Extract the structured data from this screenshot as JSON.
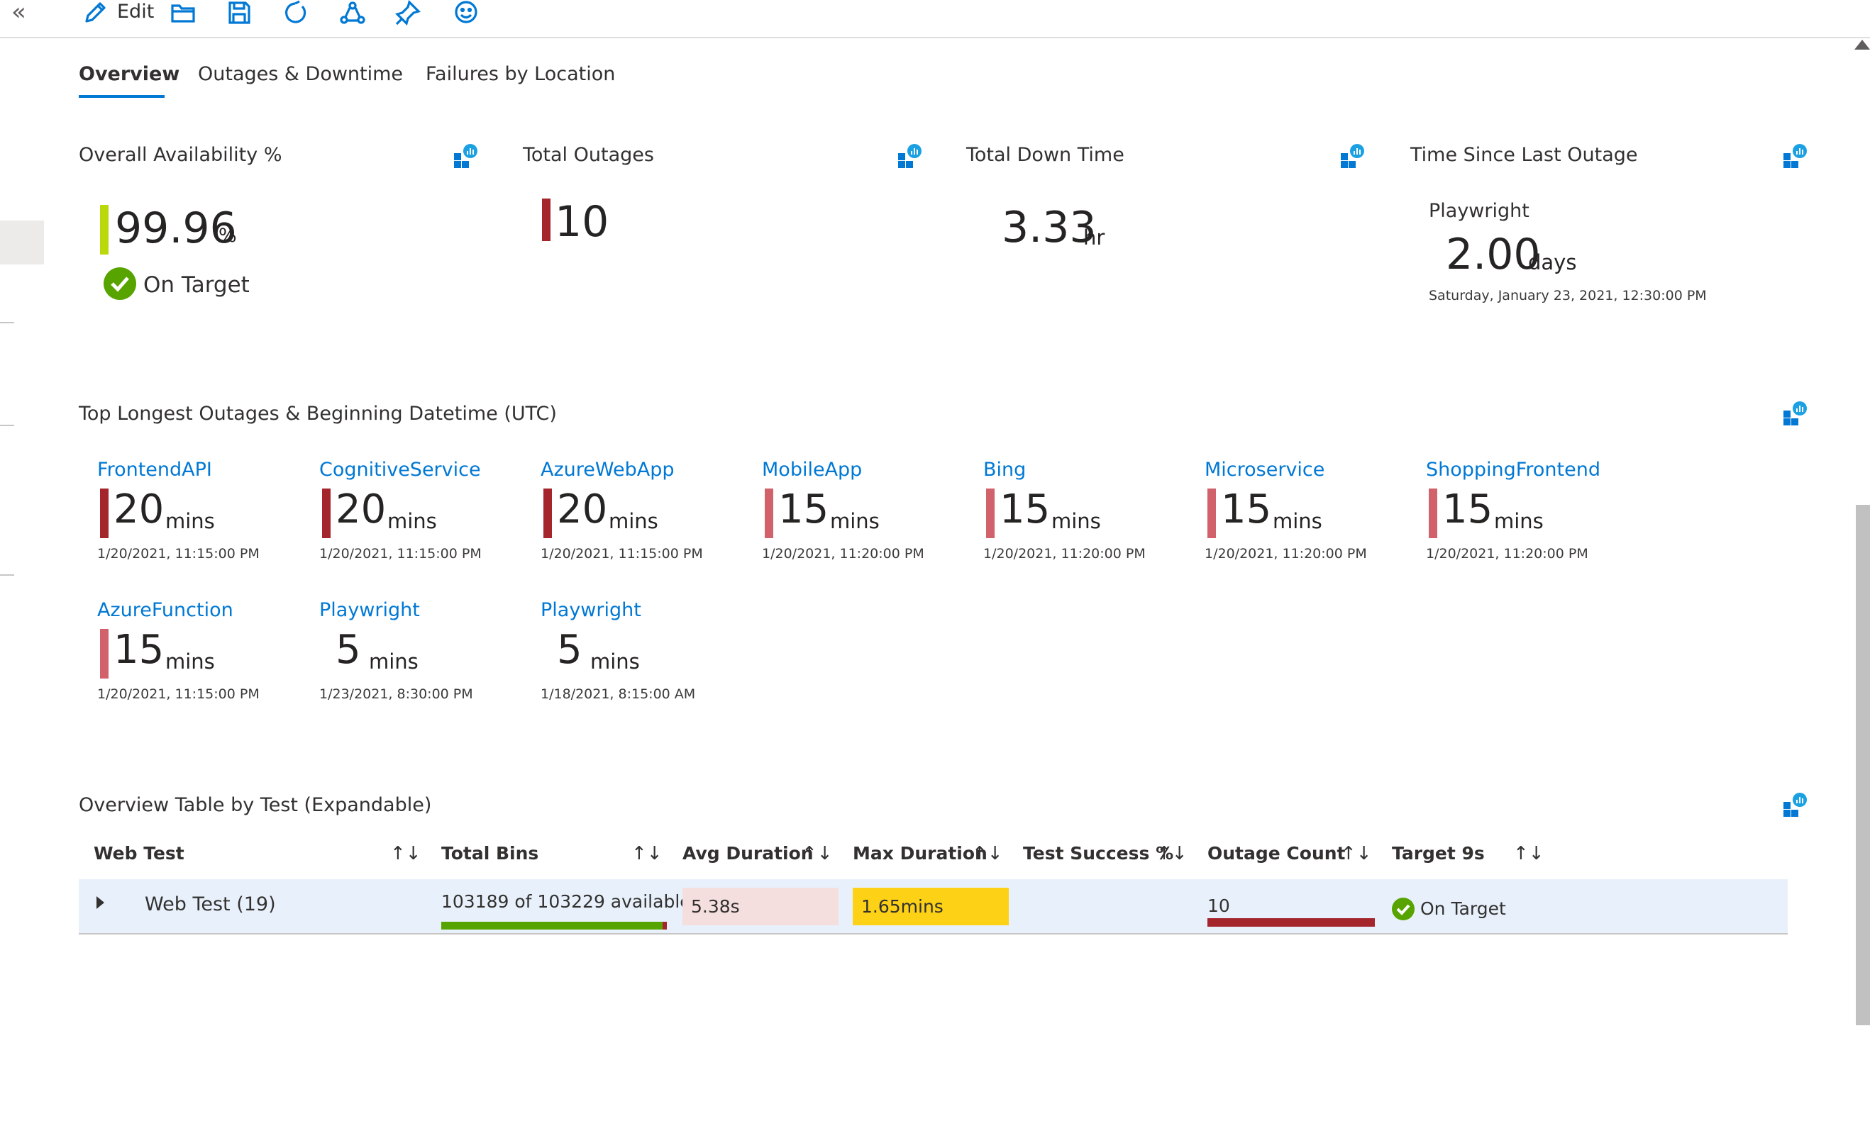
{
  "toolbar": {
    "collapse": "«",
    "edit_label": "Edit",
    "icons": [
      "edit-pencil-icon",
      "open-folder-icon",
      "save-icon",
      "refresh-icon",
      "share-icon",
      "pin-icon",
      "feedback-smiley-icon"
    ]
  },
  "tabs": [
    {
      "label": "Overview",
      "active": true
    },
    {
      "label": "Outages & Downtime",
      "active": false
    },
    {
      "label": "Failures by Location",
      "active": false
    }
  ],
  "kpis": {
    "availability": {
      "title": "Overall Availability %",
      "value": "99.96",
      "unit": "%",
      "status": "On Target"
    },
    "outages": {
      "title": "Total Outages",
      "value": "10"
    },
    "downtime": {
      "title": "Total Down Time",
      "value": "3.33",
      "unit": "hr"
    },
    "since_last": {
      "title": "Time Since Last Outage",
      "test": "Playwright",
      "value": "2.00",
      "unit": "days",
      "timestamp": "Saturday, January 23, 2021, 12:30:00 PM"
    }
  },
  "top_outages": {
    "title": "Top Longest Outages & Beginning Datetime (UTC)",
    "items": [
      {
        "name": "FrontendAPI",
        "value": "20",
        "unit": "mins",
        "time": "1/20/2021, 11:15:00 PM",
        "severity": "high"
      },
      {
        "name": "CognitiveService",
        "value": "20",
        "unit": "mins",
        "time": "1/20/2021, 11:15:00 PM",
        "severity": "high"
      },
      {
        "name": "AzureWebApp",
        "value": "20",
        "unit": "mins",
        "time": "1/20/2021, 11:15:00 PM",
        "severity": "high"
      },
      {
        "name": "MobileApp",
        "value": "15",
        "unit": "mins",
        "time": "1/20/2021, 11:20:00 PM",
        "severity": "medium"
      },
      {
        "name": "Bing",
        "value": "15",
        "unit": "mins",
        "time": "1/20/2021, 11:20:00 PM",
        "severity": "medium"
      },
      {
        "name": "Microservice",
        "value": "15",
        "unit": "mins",
        "time": "1/20/2021, 11:20:00 PM",
        "severity": "medium"
      },
      {
        "name": "ShoppingFrontend",
        "value": "15",
        "unit": "mins",
        "time": "1/20/2021, 11:20:00 PM",
        "severity": "medium"
      },
      {
        "name": "AzureFunction",
        "value": "15",
        "unit": "mins",
        "time": "1/20/2021, 11:15:00 PM",
        "severity": "medium"
      },
      {
        "name": "Playwright",
        "value": "5",
        "unit": "mins",
        "time": "1/23/2021, 8:30:00 PM",
        "severity": "none"
      },
      {
        "name": "Playwright",
        "value": "5",
        "unit": "mins",
        "time": "1/18/2021, 8:15:00 AM",
        "severity": "none"
      }
    ]
  },
  "table": {
    "title": "Overview Table by Test (Expandable)",
    "columns": [
      "Web Test",
      "Total Bins",
      "Avg Duration",
      "Max Duration",
      "Test Success %",
      "Outage Count",
      "Target 9s"
    ],
    "sort_glyph": "↑↓",
    "row": {
      "web_test": "Web Test (19)",
      "total_bins": "103189 of 103229 available",
      "total_bins_fraction": 0.9996,
      "avg_duration": "5.38s",
      "max_duration": "1.65mins",
      "test_success": "",
      "outage_count": "10",
      "target": "On Target"
    }
  },
  "colors": {
    "accent": "#0078d4",
    "severity_high": "#a4262c",
    "severity_medium": "#d1616b",
    "availability_bar": "#bad80a",
    "success": "#57a300",
    "avg_duration_bg": "#f4dede",
    "max_duration_bg": "#fcd116"
  }
}
